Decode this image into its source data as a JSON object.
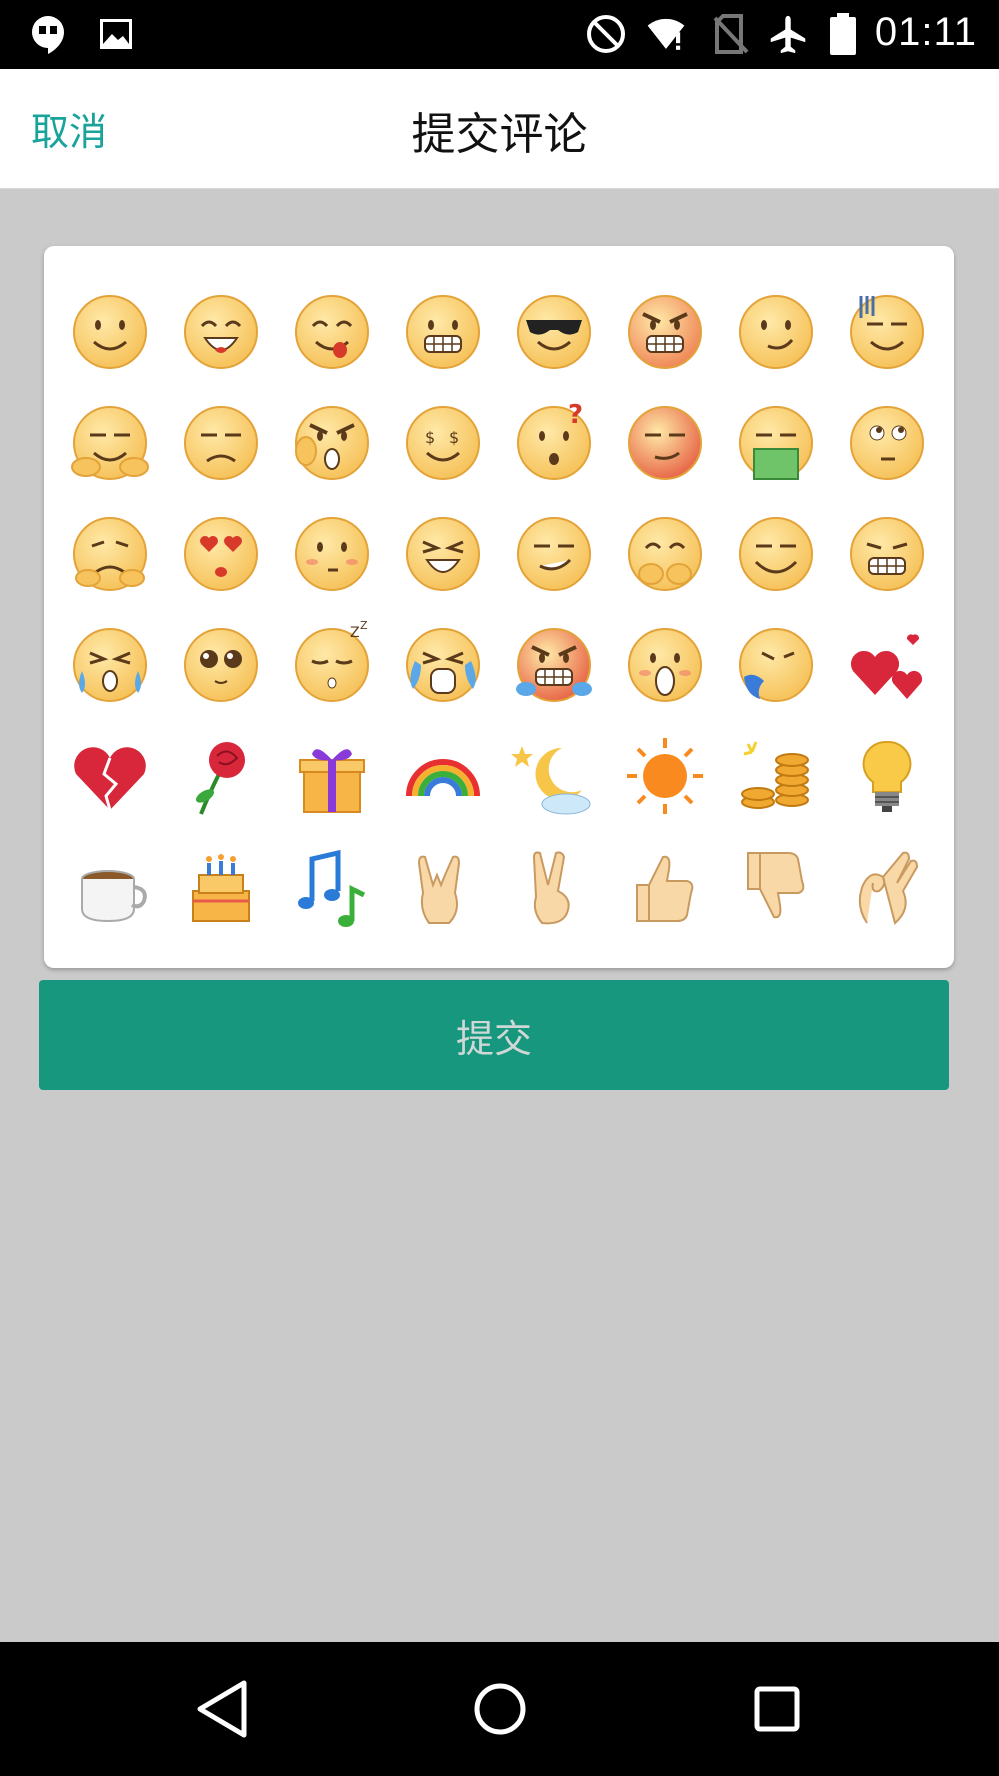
{
  "status_bar": {
    "time": "01:11",
    "left_icons": [
      "hangouts-icon",
      "image-icon"
    ],
    "right_icons": [
      "do-not-disturb-icon",
      "wifi-alert-icon",
      "no-sim-icon",
      "airplane-icon",
      "battery-icon"
    ]
  },
  "header": {
    "cancel_label": "取消",
    "title": "提交评论"
  },
  "emoji_panel": {
    "rows": [
      [
        "smile",
        "grin",
        "tongue",
        "grimace",
        "cool-sunglasses",
        "angry-teeth",
        "smirk",
        "sweat-drop-sly"
      ],
      [
        "arms-crossed-smug",
        "frown",
        "thumb-point-angry",
        "money-eyes",
        "confused-question",
        "red-sly",
        "vomit",
        "eyes-roll"
      ],
      [
        "hug-sad",
        "heart-eyes-kiss",
        "shy-blush",
        "laugh-squint",
        "smug-grin",
        "cover-mouth-laugh",
        "content-smile",
        "big-grin"
      ],
      [
        "sweat-anxious",
        "puppy-eyes",
        "sleeping-zzz",
        "crying",
        "furious-steam",
        "shocked-open-mouth",
        "puking-blue",
        "two-hearts"
      ],
      [
        "broken-heart",
        "rose",
        "gift",
        "rainbow",
        "moon-night",
        "sun",
        "coins",
        "light-bulb"
      ],
      [
        "coffee-cup",
        "birthday-cake",
        "music-notes",
        "rock-hand",
        "peace-hand",
        "thumbs-up",
        "thumbs-down",
        "ok-hand"
      ]
    ]
  },
  "submit_label": "提交",
  "nav_bar": {
    "buttons": [
      "back-icon",
      "home-icon",
      "recents-icon"
    ]
  },
  "colors": {
    "accent": "#1aa39a",
    "submit_bg": "#17977d",
    "page_bg": "#cacaca",
    "face": "#f6c35c"
  }
}
